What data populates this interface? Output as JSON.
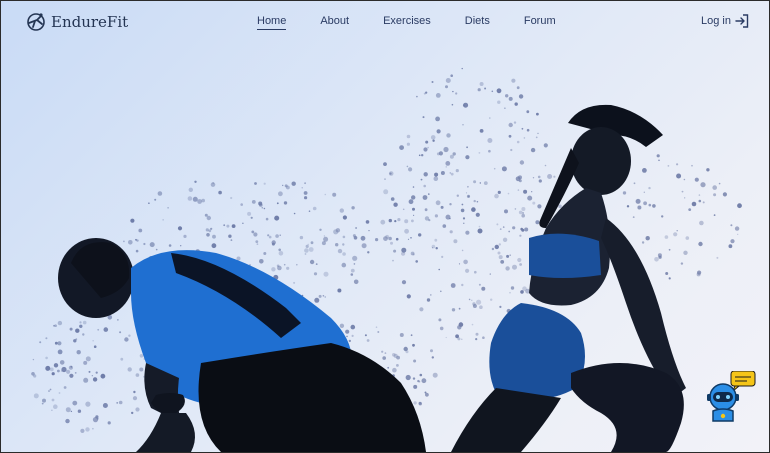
{
  "brand": {
    "name": "EndureFit"
  },
  "nav": {
    "items": [
      {
        "label": "Home",
        "active": true
      },
      {
        "label": "About",
        "active": false
      },
      {
        "label": "Exercises",
        "active": false
      },
      {
        "label": "Diets",
        "active": false
      },
      {
        "label": "Forum",
        "active": false
      }
    ],
    "login_label": "Log in"
  },
  "icons": {
    "logo": "runner-logo-icon",
    "login": "login-arrow-icon",
    "chat": "chatbot-robot-icon"
  },
  "colors": {
    "nav_text": "#2a3b63",
    "shirt": "#1f6fd1",
    "shorts": "#1a4f9a",
    "chat_bubble": "#f5c518",
    "robot": "#2b8ee6"
  }
}
